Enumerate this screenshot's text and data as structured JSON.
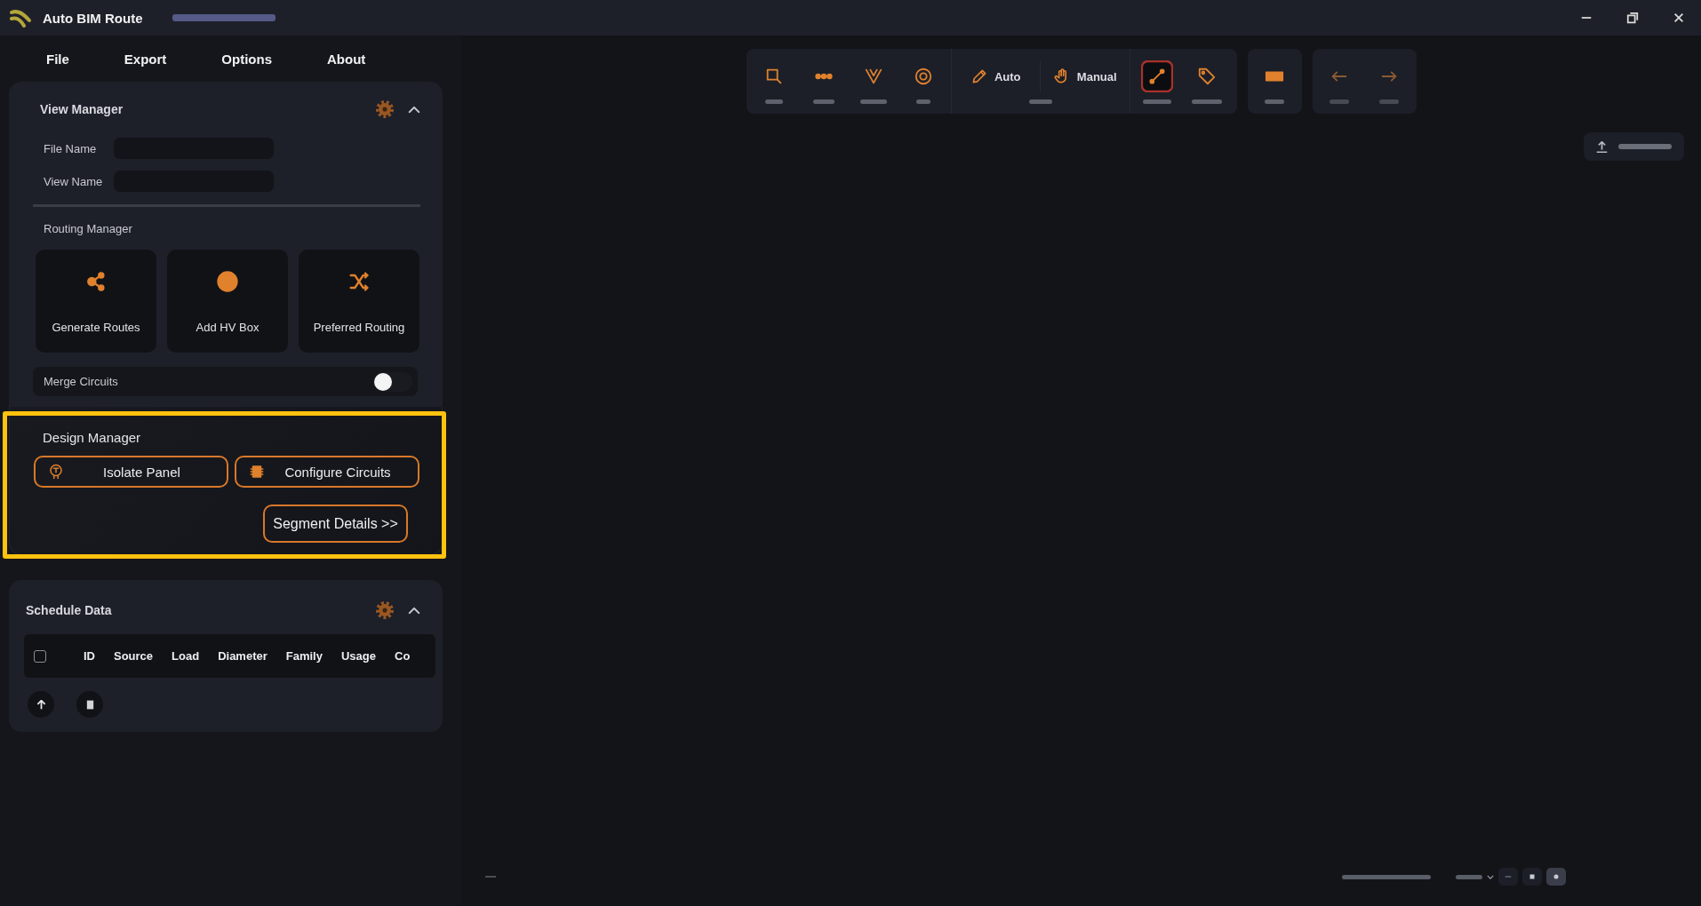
{
  "title_bar": {
    "title": "Auto BIM Route"
  },
  "menu": [
    "File",
    "Export",
    "Options",
    "About"
  ],
  "view_manager": {
    "title": "View Manager",
    "expanded": true,
    "fields": [
      {
        "label": "File Name"
      },
      {
        "label": "View Name"
      }
    ],
    "routing_manager": {
      "title": "Routing Manager",
      "actions": [
        {
          "label": "Generate Routes"
        },
        {
          "label": "Add HV Box"
        },
        {
          "label": "Preferred Routing"
        }
      ]
    },
    "merge_circuits": {
      "label": "Merge Circuits",
      "checked": false
    }
  },
  "design_manager": {
    "title": "Design Manager",
    "highlighted": true,
    "buttons": [
      {
        "label": "Isolate Panel"
      },
      {
        "label": "Configure Circuits"
      }
    ],
    "details_button": {
      "label": "Segment Details >>"
    }
  },
  "schedule_data": {
    "title": "Schedule Data",
    "expanded": true,
    "select_all": {
      "checked": false
    },
    "columns": [
      "ID",
      "Source",
      "Load",
      "Diameter",
      "Family",
      "Usage",
      "Co"
    ]
  },
  "toolbar": {
    "groups": [
      {
        "items": [
          {
            "kind": "tool",
            "selected": false,
            "disabled": false
          },
          {
            "kind": "tool",
            "selected": false,
            "disabled": false
          },
          {
            "kind": "tool",
            "selected": false,
            "disabled": false
          },
          {
            "kind": "tool",
            "selected": false,
            "disabled": false
          },
          {
            "kind": "mode_pair",
            "options": [
              {
                "label": "Auto"
              },
              {
                "label": "Manual"
              }
            ]
          },
          {
            "kind": "tool",
            "selected": true,
            "disabled": false
          },
          {
            "kind": "tool",
            "selected": false,
            "disabled": false
          }
        ]
      },
      {
        "items": [
          {
            "kind": "tool",
            "selected": false,
            "disabled": false
          }
        ]
      },
      {
        "items": [
          {
            "kind": "tool",
            "selected": false,
            "disabled": true
          },
          {
            "kind": "tool",
            "selected": false,
            "disabled": true
          }
        ]
      }
    ]
  },
  "status_bar": {
    "view_buttons": [
      {
        "selected": false
      },
      {
        "selected": false
      },
      {
        "selected": true
      }
    ]
  }
}
